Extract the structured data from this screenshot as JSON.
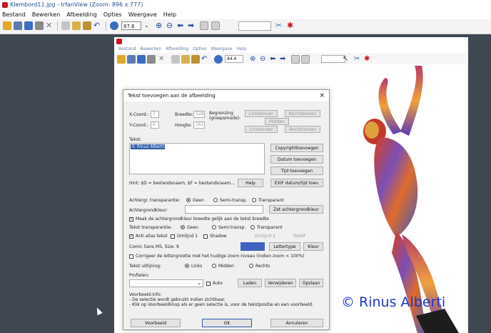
{
  "window": {
    "title": "Klembord11.jpg - IrfanView (Zoom: 896 x 777)",
    "menu": [
      "Bestand",
      "Bewerken",
      "Afbeelding",
      "Opties",
      "Weergave",
      "Help"
    ],
    "zoom_value": "87.6"
  },
  "inner": {
    "menu": [
      "Bestand",
      "Bewerken",
      "Afbeelding",
      "Opties",
      "Weergave",
      "Help"
    ],
    "zoom_value": "84.4",
    "copyright": "© Rinus Alberti"
  },
  "dialog": {
    "title": "Tekst toevoegen aan de afbeelding",
    "close": "×",
    "xcoord_label": "X-Coord.:",
    "xcoord_value": "7",
    "ycoord_label": "Y-Coord.:",
    "ycoord_value": "6",
    "breedte_label": "Breedte:",
    "breedte_value": "528",
    "hoogte_label": "Hoogte:",
    "hoogte_value": "361",
    "mode_label": "Begrenzing (groepsmode):",
    "mode_opts": [
      "Linksboven",
      "Rechtsboven",
      "Midden",
      "Linksonder",
      "Rechtsonder"
    ],
    "tekst_label": "Tekst:",
    "tekst_value": "© Rinus Alberti",
    "btn_copyright": "Copyrighttoevoegen",
    "btn_datum": "Datum toevoegen",
    "btn_tijd": "Tijd toevoegen",
    "btn_exif": "EXIF datum/tijd toev.",
    "hint": "Hint: $D = bestandsnaam, $F = bestandsnaam...",
    "btn_help": "Help",
    "achtergr_label": "Achtergr. transparantie:",
    "achtergr_opts": [
      "Geen",
      "Semi-transp.",
      "Transparant"
    ],
    "achtergrondkleur_label": "Achtergrondkleur:",
    "btn_zet": "Zet achtergrondkleur",
    "maak_label": "Maak de achtergrondkleur breedte gelijk aan de tekst breedte",
    "tekst_transp_label": "Tekst transparantie:",
    "tekst_transp_opts": [
      "Geen",
      "Semi-transp.",
      "Transparant"
    ],
    "antialias": "Anti alias tekst",
    "omlijn": "Omlijnd 1",
    "shadow": "Shadow",
    "omlijn2": "Omlijnd 2",
    "relief": "Reliëf",
    "font_label": "Comic Sans MS, Size: 9",
    "btn_lettertype": "Lettertype",
    "btn_kleur": "Kleur",
    "corrigeer_label": "Corrigeer de lettergrootte met het huidige zoom niveau (indien zoom < 100%)",
    "uitlijning_label": "Tekst uitlijning:",
    "uitlijning_opts": [
      "Links",
      "Midden",
      "Rechts"
    ],
    "profielen_label": "Profielen:",
    "auto_label": "Auto",
    "btn_laden": "Laden",
    "btn_verwijderen": "Verwijderen",
    "btn_opslaan": "Opslaan",
    "info_lines": [
      "Voorbeeld-info:",
      "- De selectie wordt gebruikt indien zichtbaar.",
      "- Klik op Voorbeeldknop als er geen selectie is, voor de tekstpositie en een voorbeeld."
    ],
    "btn_voorbeeld": "Voorbeeld",
    "btn_ok": "OK",
    "btn_annuleren": "Annuleren"
  },
  "colors": {
    "accent": "#2f5aa8",
    "brand_red": "#c9141e",
    "text_color_swatch": "#3f63bf"
  }
}
